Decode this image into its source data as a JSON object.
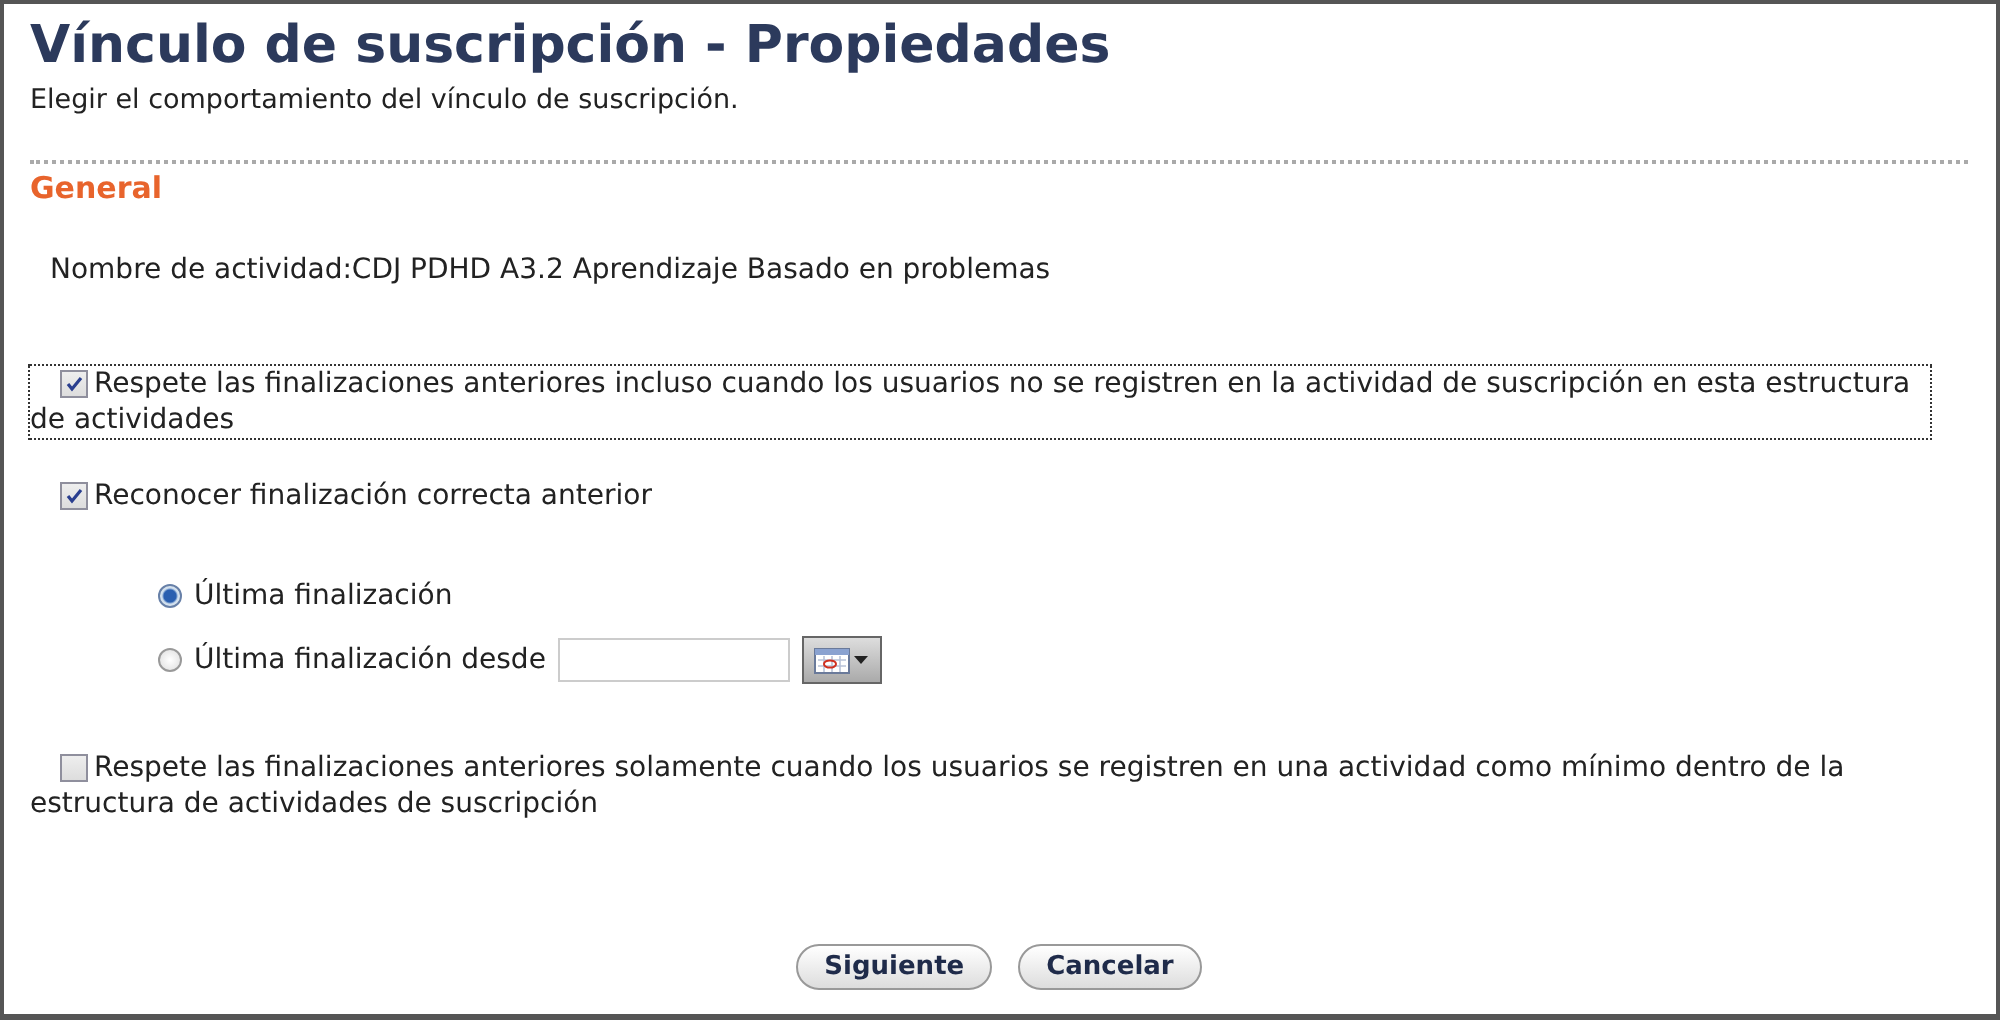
{
  "title": "Vínculo de suscripción - Propiedades",
  "subtitle": "Elegir el comportamiento del vínculo de suscripción.",
  "section": "General",
  "activity_name": "Nombre de actividad:CDJ PDHD A3.2 Aprendizaje Basado en problemas",
  "options": [
    {
      "kind": "checkbox",
      "label": "Respete las finalizaciones anteriores incluso cuando los usuarios no se registren en la actividad de suscripción en esta estructura de actividades",
      "checked": true,
      "focused": true
    },
    {
      "kind": "checkbox",
      "label": "Reconocer finalización correcta anterior",
      "checked": true,
      "focused": false,
      "children": [
        {
          "kind": "radio",
          "label": "Última finalización",
          "selected": true
        },
        {
          "kind": "radio-date",
          "label": "Última finalización desde",
          "selected": false
        }
      ]
    },
    {
      "kind": "checkbox",
      "label": "Respete las finalizaciones anteriores solamente cuando los usuarios se registren en una actividad como mínimo dentro de la estructura de actividades de suscripción",
      "checked": false,
      "focused": false
    }
  ],
  "buttons": [
    "Siguiente",
    "Cancelar"
  ]
}
